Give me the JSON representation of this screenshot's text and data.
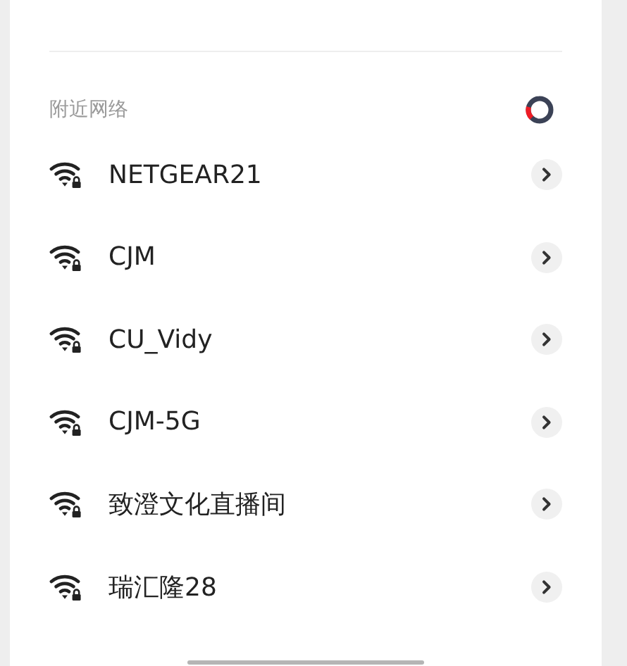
{
  "section_title": "附近网络",
  "loading": true,
  "networks": [
    {
      "name": "NETGEAR21",
      "secured": true
    },
    {
      "name": "CJM",
      "secured": true
    },
    {
      "name": "CU_Vidy",
      "secured": true
    },
    {
      "name": "CJM-5G",
      "secured": true
    },
    {
      "name": "致澄文化直播间",
      "secured": true
    },
    {
      "name": "瑞汇隆28",
      "secured": true
    }
  ]
}
